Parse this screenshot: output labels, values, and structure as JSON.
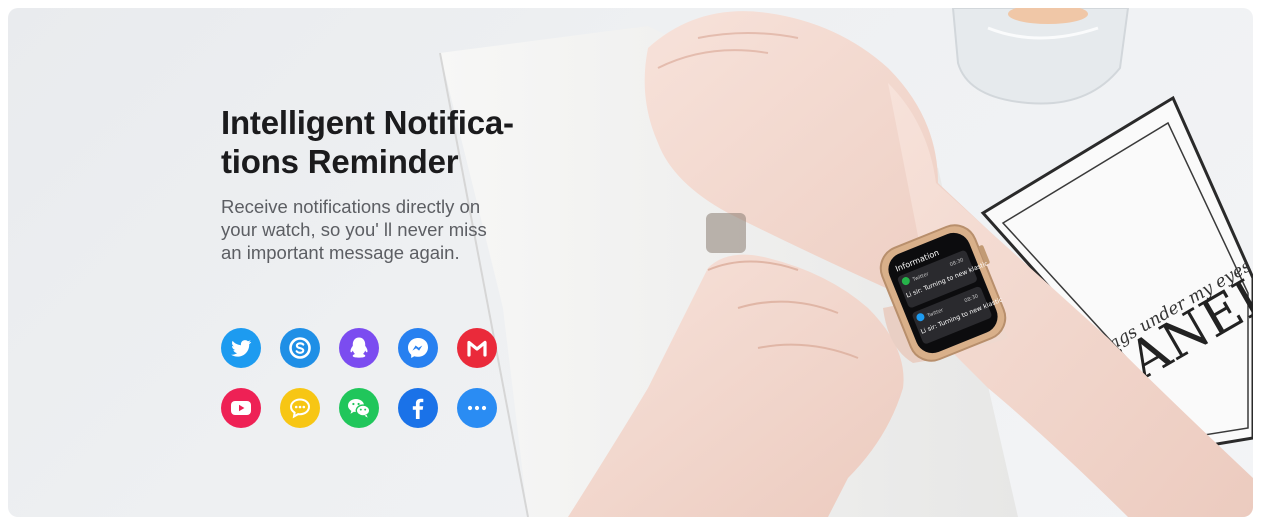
{
  "banner": {
    "headline_line1": "Intelligent Notifica-",
    "headline_line2": "tions Reminder",
    "description_line1": "Receive notifications directly on",
    "description_line2": "your watch, so you' ll never miss",
    "description_line3": "an important message again."
  },
  "app_icons": [
    [
      {
        "name": "twitter-icon",
        "color": "#1d9bf0"
      },
      {
        "name": "skype-icon",
        "color": "#1f8fe6"
      },
      {
        "name": "qq-icon",
        "color": "#7b4cf0"
      },
      {
        "name": "messenger-icon",
        "color": "#2780f0"
      },
      {
        "name": "gmail-icon",
        "color": "#ea2a3a"
      }
    ],
    [
      {
        "name": "youtube-icon",
        "color": "#ee2155"
      },
      {
        "name": "message-icon",
        "color": "#f7c614"
      },
      {
        "name": "wechat-icon",
        "color": "#20c65b"
      },
      {
        "name": "facebook-icon",
        "color": "#1a72e8"
      },
      {
        "name": "more-icon",
        "color": "#2a8cf3"
      }
    ]
  ],
  "watch_screen": {
    "title": "Information",
    "notifications": [
      {
        "app": "Twitter",
        "time": "08:30",
        "text": "Li sir: Turning to new klastic"
      },
      {
        "app": "Twitter",
        "time": "08:30",
        "text": "Li sir: Turning to new klastic"
      }
    ]
  },
  "poster": {
    "script_text": "e bags under my eyes are",
    "brand_text": "HANEL"
  },
  "colors": {
    "headline": "#1b1b1d",
    "description": "#5c5e63",
    "background": "#eceef1",
    "watch_band": "#efd9cf"
  }
}
